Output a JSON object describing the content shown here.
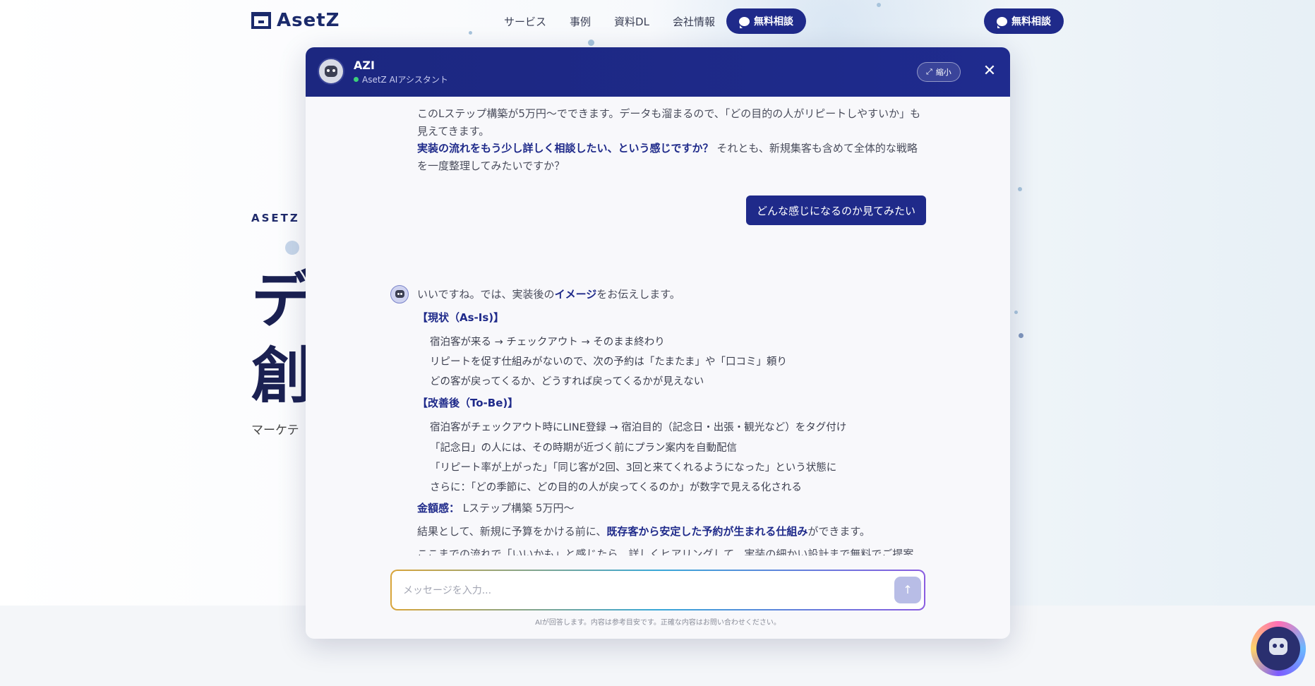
{
  "header": {
    "logo_text": "AsetZ",
    "nav": [
      "サービス",
      "事例",
      "資料DL",
      "会社情報"
    ],
    "cta_label": "無料相談"
  },
  "hero": {
    "eyebrow": "ASETZ M",
    "line1": "デ",
    "line2": "創",
    "sub": "マーケテ"
  },
  "chat_window": {
    "assistant_name": "AZI",
    "assistant_sub": "AsetZ AIアシスタント",
    "shrink_label": "縮小",
    "close_symbol": "✕",
    "prev_bot": {
      "p1": "このLステップ構築が5万円〜でできます。データも溜まるので、「どの目的の人がリピートしやすいか」も見えてきます。",
      "p2_strong": "実装の流れをもう少し詳しく相談したい、という感じですか？",
      "p2_rest": " それとも、新規集客も含めて全体的な戦略を一度整理してみたいですか？"
    },
    "user_message": "どんな感じになるのか見てみたい",
    "bot_reply": {
      "intro_a": "いいですね。では、実装後の",
      "intro_strong": "イメージ",
      "intro_b": "をお伝えします。",
      "asis_title": "【現状（As-Is)】",
      "asis_items": [
        "宿泊客が来る → チェックアウト → そのまま終わり",
        "リピートを促す仕組みがないので、次の予約は「たまたま」や「口コミ」頼り",
        "どの客が戻ってくるか、どうすれば戻ってくるかが見えない"
      ],
      "tobe_title": "【改善後（To-Be)】",
      "tobe_items": [
        "宿泊客がチェックアウト時にLINE登録 → 宿泊目的（記念日・出張・観光など）をタグ付け",
        "「記念日」の人には、その時期が近づく前にプラン案内を自動配信",
        "「リピート率が上がった」「同じ客が2回、3回と来てくれるようになった」という状態に",
        "さらに：「どの季節に、どの目的の人が戻ってくるのか」が数字で見える化される"
      ],
      "price_label": "金額感：",
      "price_value": " Lステップ構築 5万円〜",
      "result_a": "結果として、新規に予算をかける前に、",
      "result_strong": "既存客から安定した予約が生まれる仕組み",
      "result_b": "ができます。",
      "closing": "ここまでの流れで「いいかも」と感じたら、詳しくヒアリングして、実装の細かい設計まで無料でご提案できます。どうですか？"
    },
    "input_placeholder": "メッセージを入力...",
    "send_icon": "↑",
    "disclaimer": "AIが回答します。内容は参考目安です。正確な内容はお問い合わせください。"
  }
}
